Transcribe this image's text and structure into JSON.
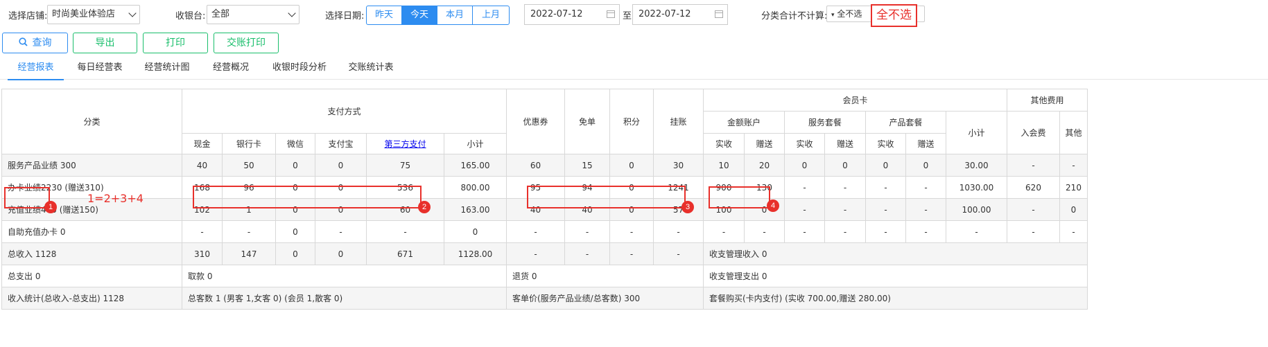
{
  "toolbar": {
    "store_label": "选择店铺:",
    "store_value": "时尚美业体验店",
    "cashier_label": "收银台:",
    "cashier_value": "全部",
    "date_label": "选择日期:",
    "date_buttons": [
      "昨天",
      "今天",
      "本月",
      "上月"
    ],
    "date_active": "今天",
    "start_date": "2022-07-12",
    "to_label": "至",
    "end_date": "2022-07-12",
    "category_label": "分类合计不计算:",
    "category_value": "全不选",
    "annotation_text": "全不选"
  },
  "actions": {
    "query": "查询",
    "export": "导出",
    "print": "打印",
    "shift_print": "交账打印"
  },
  "tabs": [
    "经营报表",
    "每日经营表",
    "经营统计图",
    "经营概况",
    "收银时段分析",
    "交账统计表"
  ],
  "table": {
    "h_category": "分类",
    "h_payment": "支付方式",
    "h_cash": "现金",
    "h_bank": "银行卡",
    "h_wechat": "微信",
    "h_alipay": "支付宝",
    "h_third": "第三方支付",
    "h_subtotal": "小计",
    "h_coupon": "优惠券",
    "h_free": "免单",
    "h_points": "积分",
    "h_credit": "挂账",
    "h_member": "会员卡",
    "h_amount_account": "金额账户",
    "h_service_pkg": "服务套餐",
    "h_product_pkg": "产品套餐",
    "h_actual": "实收",
    "h_gift": "赠送",
    "h_member_subtotal": "小计",
    "h_other": "其他费用",
    "h_join_fee": "入会费",
    "h_other_cut": "其他",
    "rows": [
      {
        "label": "服务产品业绩 300",
        "cells": [
          "40",
          "50",
          "0",
          "0",
          "75",
          "165.00",
          "60",
          "15",
          "0",
          "30",
          "10",
          "20",
          "0",
          "0",
          "0",
          "0",
          "30.00",
          "-",
          "-"
        ]
      },
      {
        "label": "办卡业绩2230 (赠送310)",
        "cells": [
          "168",
          "96",
          "0",
          "0",
          "536",
          "800.00",
          "95",
          "94",
          "0",
          "1241",
          "900",
          "130",
          "-",
          "-",
          "-",
          "-",
          "1030.00",
          "620",
          "210"
        ]
      },
      {
        "label_a": "充值业绩400",
        "label_b": " (赠送150)",
        "cells": [
          "102",
          "1",
          "0",
          "0",
          "60",
          "163.00",
          "40",
          "40",
          "0",
          "57",
          "100",
          "0",
          "-",
          "-",
          "-",
          "-",
          "100.00",
          "-",
          "0"
        ]
      },
      {
        "label": "自助充值办卡 0",
        "cells": [
          "-",
          "-",
          "0",
          "-",
          "-",
          "0",
          "-",
          "-",
          "-",
          "-",
          "-",
          "-",
          "-",
          "-",
          "-",
          "-",
          "-",
          "-",
          "-"
        ]
      },
      {
        "label": "总收入 1128",
        "cells": [
          "310",
          "147",
          "0",
          "0",
          "671",
          "1128.00",
          "-",
          "-",
          "-",
          "-"
        ],
        "tail": "收支管理收入 0"
      }
    ],
    "footer": [
      {
        "a": "总支出 0",
        "b": "取款 0",
        "c": "退货 0",
        "d": "收支管理支出 0"
      },
      {
        "a": "收入统计(总收入-总支出) 1128",
        "b": "总客数 1 (男客 1,女客 0) (会员 1,散客 0)",
        "c": "客单价(服务产品业绩/总客数) 300",
        "d": "套餐购买(卡内支付) (实收 700.00,赠送 280.00)"
      }
    ]
  },
  "annotations": {
    "formula": "1=2+3+4",
    "badges": [
      "1",
      "2",
      "3",
      "4"
    ]
  },
  "colors": {
    "accent": "#2d8cf0",
    "green": "#19be6b",
    "annotation_red": "#e8302b",
    "header_bg": "#ffffff",
    "row_alt_bg": "#f5f5f5"
  }
}
